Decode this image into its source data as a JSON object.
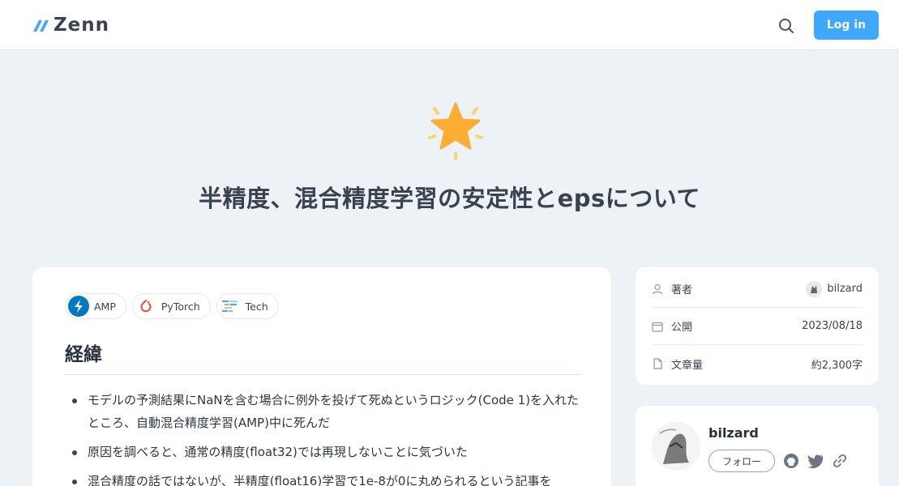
{
  "header": {
    "logo_text": "Zenn",
    "login_label": "Log in",
    "search_icon": "search-icon"
  },
  "hero": {
    "emoji": "star",
    "title": "半精度、混合精度学習の安定性とepsについて"
  },
  "article": {
    "tags": [
      {
        "label": "AMP",
        "icon": "amp-icon"
      },
      {
        "label": "PyTorch",
        "icon": "pytorch-icon"
      },
      {
        "label": "Tech",
        "icon": "tech-icon"
      }
    ],
    "section_heading": "経緯",
    "bullets": [
      "モデルの予測結果にNaNを含む場合に例外を投げて死ぬというロジック(Code 1)を入れたところ、自動混合精度学習(AMP)中に死んだ",
      "原因を調べると、通常の精度(float32)では再現しないことに気づいた",
      "混合精度の話ではないが、半精度(float16)学習で1e-8が0に丸められるという記事を"
    ]
  },
  "info": {
    "author_label": "著者",
    "author_value": "bilzard",
    "published_label": "公開",
    "published_value": "2023/08/18",
    "length_label": "文章量",
    "length_value": "約2,300字"
  },
  "author_card": {
    "name": "bilzard",
    "follow_label": "フォロー",
    "social_icons": [
      "github-icon",
      "twitter-icon",
      "link-icon"
    ]
  },
  "colors": {
    "accent": "#3ea8ff",
    "background": "#edf2f7"
  }
}
